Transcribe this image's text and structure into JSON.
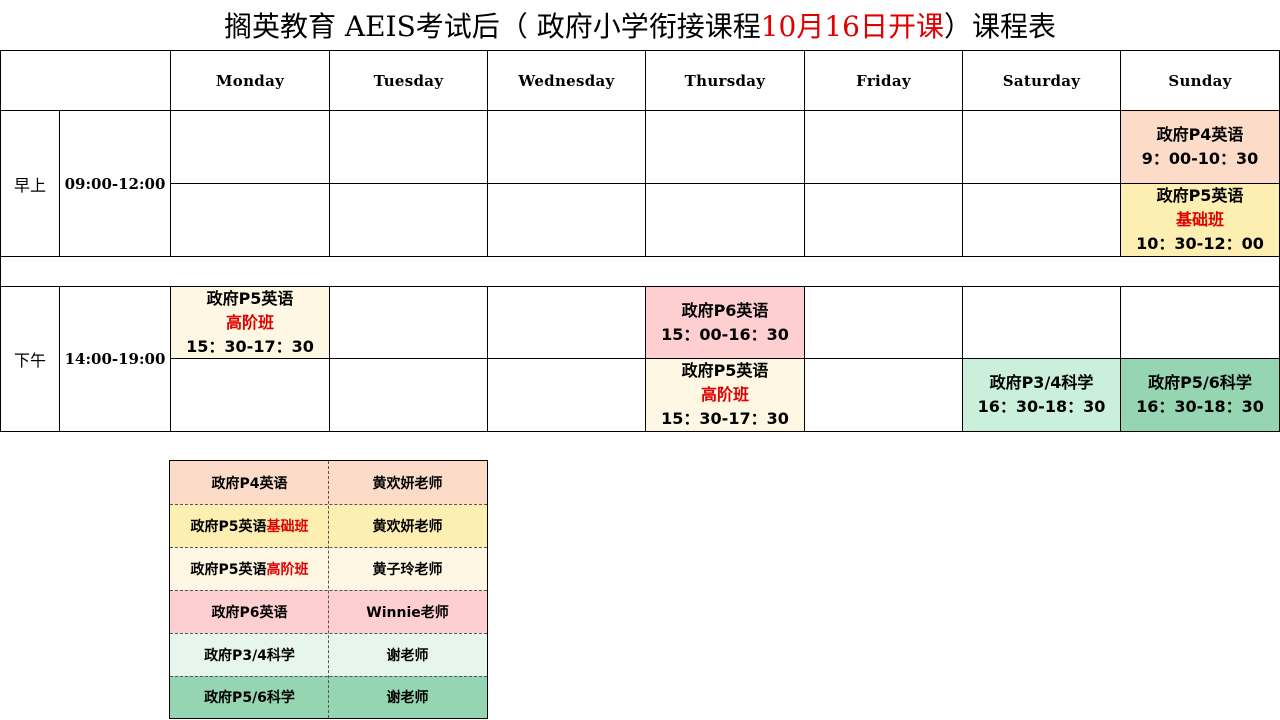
{
  "title": {
    "prefix": "搁英教育 AEIS考试后（ 政府小学衔接课程",
    "highlight": "10月16日开课",
    "suffix": "）课程表"
  },
  "days": [
    "Monday",
    "Tuesday",
    "Wednesday",
    "Thursday",
    "Friday",
    "Saturday",
    "Sunday"
  ],
  "morning": {
    "label": "早上",
    "time": "09:00-12:00"
  },
  "afternoon": {
    "label": "下午",
    "time": "14:00-19:00"
  },
  "classes": {
    "sun_am1": {
      "name": "政府P4英语",
      "time": "9：00-10：30"
    },
    "sun_am2": {
      "name": "政府P5英语",
      "level": "基础班",
      "time": "10：30-12：00"
    },
    "mon_pm1": {
      "name": "政府P5英语",
      "level": "高阶班",
      "time": "15：30-17：30"
    },
    "thu_pm1": {
      "name": "政府P6英语",
      "time": "15：00-16：30"
    },
    "thu_pm2": {
      "name": "政府P5英语",
      "level": "高阶班",
      "time": "15：30-17：30"
    },
    "sat_pm2": {
      "name": "政府P3/4科学",
      "time": "16：30-18：30"
    },
    "sun_pm2": {
      "name": "政府P5/6科学",
      "time": "16：30-18：30"
    }
  },
  "legend": [
    {
      "course": "政府P4英语",
      "level": "",
      "teacher": "黄欢妍老师",
      "color": "#fcdcc8"
    },
    {
      "course": "政府P5英语",
      "level": "基础班",
      "teacher": "黄欢妍老师",
      "color": "#fdeeb1"
    },
    {
      "course": "政府P5英语",
      "level": "高阶班",
      "teacher": "黄子玲老师",
      "color": "#fdf7e4"
    },
    {
      "course": "政府P6英语",
      "level": "",
      "teacher": "Winnie老师",
      "color": "#fdcfd0"
    },
    {
      "course": "政府P3/4科学",
      "level": "",
      "teacher": "谢老师",
      "color": "#e7f6ec"
    },
    {
      "course": "政府P5/6科学",
      "level": "",
      "teacher": "谢老师",
      "color": "#95d5b1"
    }
  ]
}
